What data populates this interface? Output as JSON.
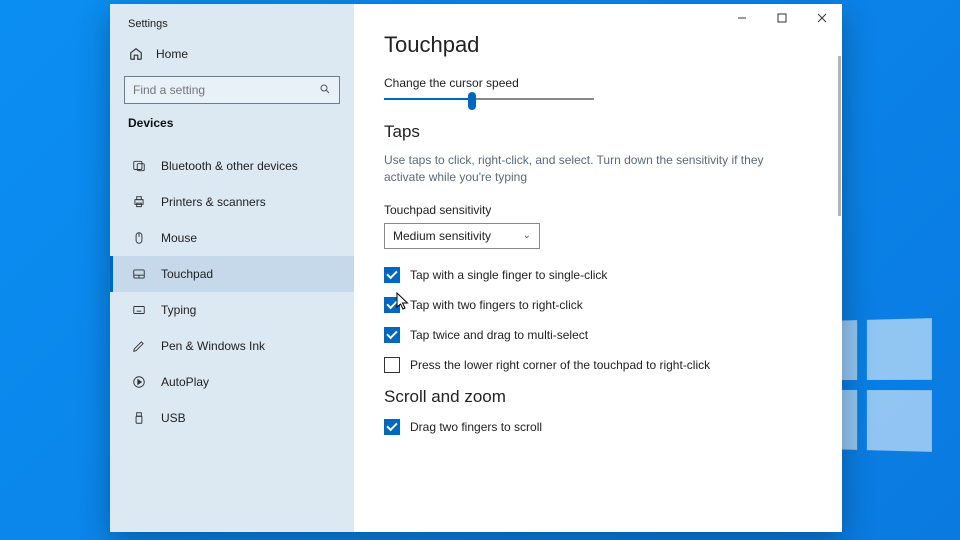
{
  "window": {
    "title": "Settings"
  },
  "sidebar": {
    "home_label": "Home",
    "search_placeholder": "Find a setting",
    "category": "Devices",
    "items": [
      {
        "label": "Bluetooth & other devices",
        "icon": "bluetooth-icon"
      },
      {
        "label": "Printers & scanners",
        "icon": "printer-icon"
      },
      {
        "label": "Mouse",
        "icon": "mouse-icon"
      },
      {
        "label": "Touchpad",
        "icon": "touchpad-icon"
      },
      {
        "label": "Typing",
        "icon": "keyboard-icon"
      },
      {
        "label": "Pen & Windows Ink",
        "icon": "pen-icon"
      },
      {
        "label": "AutoPlay",
        "icon": "autoplay-icon"
      },
      {
        "label": "USB",
        "icon": "usb-icon"
      }
    ],
    "selected_index": 3
  },
  "page": {
    "title": "Touchpad",
    "cursor_speed_label": "Change the cursor speed",
    "slider_value_percent": 42,
    "taps": {
      "heading": "Taps",
      "description": "Use taps to click, right-click, and select. Turn down the sensitivity if they activate while you're typing",
      "sensitivity_label": "Touchpad sensitivity",
      "sensitivity_value": "Medium sensitivity",
      "checks": [
        {
          "label": "Tap with a single finger to single-click",
          "checked": true
        },
        {
          "label": "Tap with two fingers to right-click",
          "checked": true
        },
        {
          "label": "Tap twice and drag to multi-select",
          "checked": true
        },
        {
          "label": "Press the lower right corner of the touchpad to right-click",
          "checked": false
        }
      ]
    },
    "scroll": {
      "heading": "Scroll and zoom",
      "checks": [
        {
          "label": "Drag two fingers to scroll",
          "checked": true
        }
      ]
    }
  },
  "colors": {
    "accent": "#0067c0"
  }
}
